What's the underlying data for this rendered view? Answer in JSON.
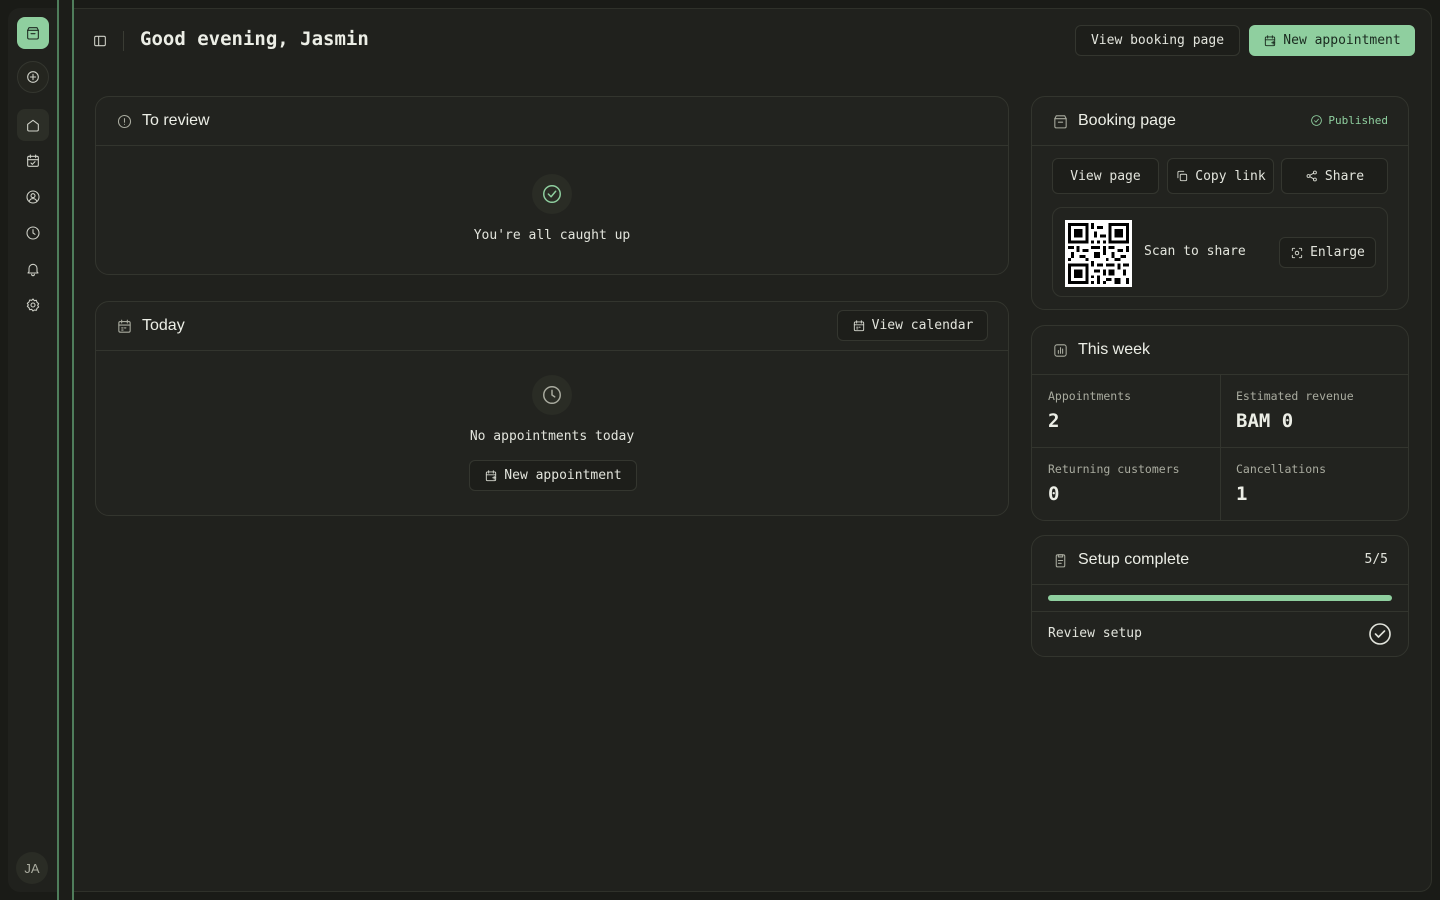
{
  "rail": {
    "items": [
      "home-icon",
      "calendar-icon",
      "user-icon",
      "clock-icon",
      "bell-icon",
      "settings-icon"
    ],
    "avatar_initials": "JA"
  },
  "header": {
    "greeting": "Good evening, Jasmin",
    "view_booking_label": "View booking page",
    "new_appointment_label": "New appointment"
  },
  "to_review": {
    "title": "To review",
    "empty_text": "You're all caught up"
  },
  "today": {
    "title": "Today",
    "view_calendar_label": "View calendar",
    "empty_text": "No appointments today",
    "new_appointment_label": "New appointment"
  },
  "booking_page": {
    "title": "Booking page",
    "status": "Published",
    "view_page_label": "View page",
    "copy_link_label": "Copy link",
    "share_label": "Share",
    "scan_text": "Scan to share",
    "enlarge_label": "Enlarge"
  },
  "this_week": {
    "title": "This week",
    "stats": [
      {
        "label": "Appointments",
        "value": "2"
      },
      {
        "label": "Estimated revenue",
        "value": "BAM 0"
      },
      {
        "label": "Returning customers",
        "value": "0"
      },
      {
        "label": "Cancellations",
        "value": "1"
      }
    ]
  },
  "setup": {
    "title": "Setup complete",
    "progress_text": "5/5",
    "progress_fraction": 1.0,
    "review_label": "Review setup"
  },
  "colors": {
    "accent": "#8fcf9f",
    "background": "#1a1b17",
    "panel": "#20211d"
  }
}
